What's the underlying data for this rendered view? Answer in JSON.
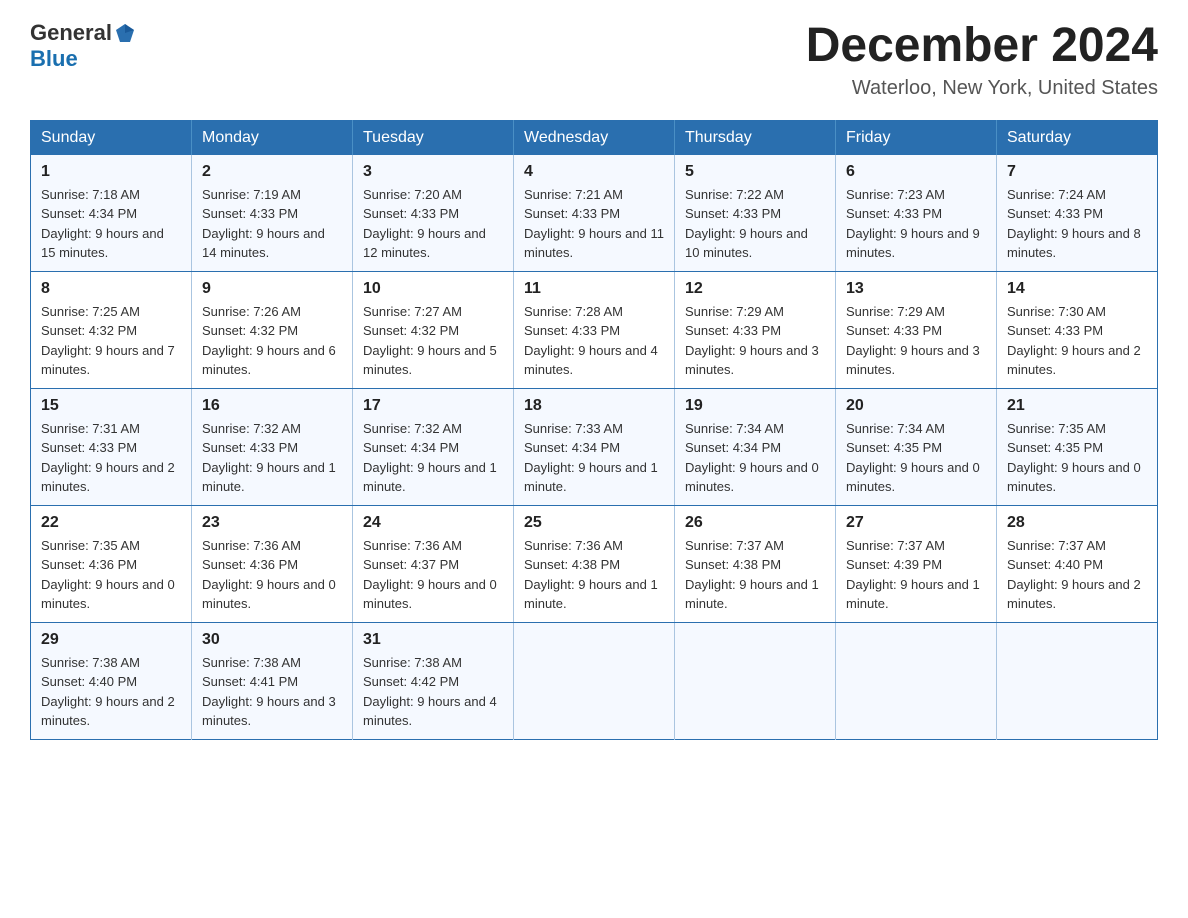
{
  "header": {
    "logo_general": "General",
    "logo_blue": "Blue",
    "month_title": "December 2024",
    "location": "Waterloo, New York, United States"
  },
  "days_of_week": [
    "Sunday",
    "Monday",
    "Tuesday",
    "Wednesday",
    "Thursday",
    "Friday",
    "Saturday"
  ],
  "weeks": [
    [
      {
        "day": "1",
        "sunrise": "7:18 AM",
        "sunset": "4:34 PM",
        "daylight": "9 hours and 15 minutes."
      },
      {
        "day": "2",
        "sunrise": "7:19 AM",
        "sunset": "4:33 PM",
        "daylight": "9 hours and 14 minutes."
      },
      {
        "day": "3",
        "sunrise": "7:20 AM",
        "sunset": "4:33 PM",
        "daylight": "9 hours and 12 minutes."
      },
      {
        "day": "4",
        "sunrise": "7:21 AM",
        "sunset": "4:33 PM",
        "daylight": "9 hours and 11 minutes."
      },
      {
        "day": "5",
        "sunrise": "7:22 AM",
        "sunset": "4:33 PM",
        "daylight": "9 hours and 10 minutes."
      },
      {
        "day": "6",
        "sunrise": "7:23 AM",
        "sunset": "4:33 PM",
        "daylight": "9 hours and 9 minutes."
      },
      {
        "day": "7",
        "sunrise": "7:24 AM",
        "sunset": "4:33 PM",
        "daylight": "9 hours and 8 minutes."
      }
    ],
    [
      {
        "day": "8",
        "sunrise": "7:25 AM",
        "sunset": "4:32 PM",
        "daylight": "9 hours and 7 minutes."
      },
      {
        "day": "9",
        "sunrise": "7:26 AM",
        "sunset": "4:32 PM",
        "daylight": "9 hours and 6 minutes."
      },
      {
        "day": "10",
        "sunrise": "7:27 AM",
        "sunset": "4:32 PM",
        "daylight": "9 hours and 5 minutes."
      },
      {
        "day": "11",
        "sunrise": "7:28 AM",
        "sunset": "4:33 PM",
        "daylight": "9 hours and 4 minutes."
      },
      {
        "day": "12",
        "sunrise": "7:29 AM",
        "sunset": "4:33 PM",
        "daylight": "9 hours and 3 minutes."
      },
      {
        "day": "13",
        "sunrise": "7:29 AM",
        "sunset": "4:33 PM",
        "daylight": "9 hours and 3 minutes."
      },
      {
        "day": "14",
        "sunrise": "7:30 AM",
        "sunset": "4:33 PM",
        "daylight": "9 hours and 2 minutes."
      }
    ],
    [
      {
        "day": "15",
        "sunrise": "7:31 AM",
        "sunset": "4:33 PM",
        "daylight": "9 hours and 2 minutes."
      },
      {
        "day": "16",
        "sunrise": "7:32 AM",
        "sunset": "4:33 PM",
        "daylight": "9 hours and 1 minute."
      },
      {
        "day": "17",
        "sunrise": "7:32 AM",
        "sunset": "4:34 PM",
        "daylight": "9 hours and 1 minute."
      },
      {
        "day": "18",
        "sunrise": "7:33 AM",
        "sunset": "4:34 PM",
        "daylight": "9 hours and 1 minute."
      },
      {
        "day": "19",
        "sunrise": "7:34 AM",
        "sunset": "4:34 PM",
        "daylight": "9 hours and 0 minutes."
      },
      {
        "day": "20",
        "sunrise": "7:34 AM",
        "sunset": "4:35 PM",
        "daylight": "9 hours and 0 minutes."
      },
      {
        "day": "21",
        "sunrise": "7:35 AM",
        "sunset": "4:35 PM",
        "daylight": "9 hours and 0 minutes."
      }
    ],
    [
      {
        "day": "22",
        "sunrise": "7:35 AM",
        "sunset": "4:36 PM",
        "daylight": "9 hours and 0 minutes."
      },
      {
        "day": "23",
        "sunrise": "7:36 AM",
        "sunset": "4:36 PM",
        "daylight": "9 hours and 0 minutes."
      },
      {
        "day": "24",
        "sunrise": "7:36 AM",
        "sunset": "4:37 PM",
        "daylight": "9 hours and 0 minutes."
      },
      {
        "day": "25",
        "sunrise": "7:36 AM",
        "sunset": "4:38 PM",
        "daylight": "9 hours and 1 minute."
      },
      {
        "day": "26",
        "sunrise": "7:37 AM",
        "sunset": "4:38 PM",
        "daylight": "9 hours and 1 minute."
      },
      {
        "day": "27",
        "sunrise": "7:37 AM",
        "sunset": "4:39 PM",
        "daylight": "9 hours and 1 minute."
      },
      {
        "day": "28",
        "sunrise": "7:37 AM",
        "sunset": "4:40 PM",
        "daylight": "9 hours and 2 minutes."
      }
    ],
    [
      {
        "day": "29",
        "sunrise": "7:38 AM",
        "sunset": "4:40 PM",
        "daylight": "9 hours and 2 minutes."
      },
      {
        "day": "30",
        "sunrise": "7:38 AM",
        "sunset": "4:41 PM",
        "daylight": "9 hours and 3 minutes."
      },
      {
        "day": "31",
        "sunrise": "7:38 AM",
        "sunset": "4:42 PM",
        "daylight": "9 hours and 4 minutes."
      },
      null,
      null,
      null,
      null
    ]
  ]
}
